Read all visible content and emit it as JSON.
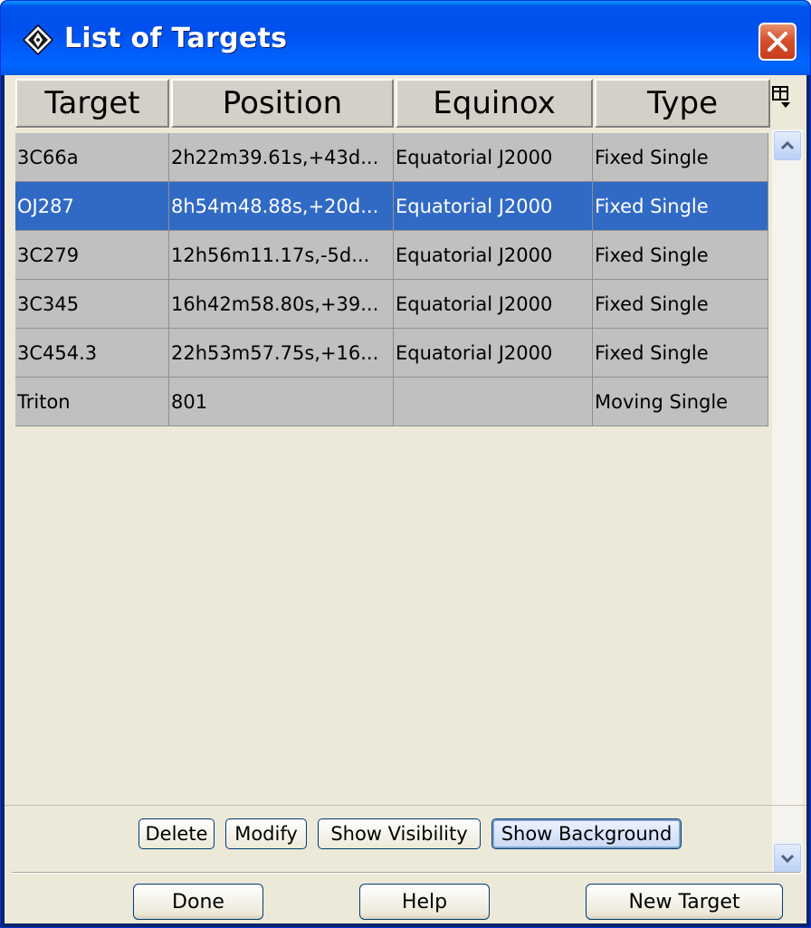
{
  "window": {
    "title": "List of Targets",
    "close_icon": "close-icon",
    "app_icon": "diamond-compass-icon"
  },
  "table": {
    "columns": [
      "Target",
      "Position",
      "Equinox",
      "Type"
    ],
    "column_chooser_icon": "column-chooser-icon",
    "selected_row": 1,
    "rows": [
      {
        "target": "3C66a",
        "position": "2h22m39.61s,+43d...",
        "equinox": "Equatorial J2000",
        "type": "Fixed Single"
      },
      {
        "target": "OJ287",
        "position": "8h54m48.88s,+20d...",
        "equinox": "Equatorial J2000",
        "type": "Fixed Single"
      },
      {
        "target": "3C279",
        "position": "12h56m11.17s,-5d...",
        "equinox": "Equatorial J2000",
        "type": "Fixed Single"
      },
      {
        "target": "3C345",
        "position": "16h42m58.80s,+39...",
        "equinox": "Equatorial J2000",
        "type": "Fixed Single"
      },
      {
        "target": "3C454.3",
        "position": "22h53m57.75s,+16...",
        "equinox": "Equatorial J2000",
        "type": "Fixed Single"
      },
      {
        "target": "Triton",
        "position": "801",
        "equinox": "",
        "type": "Moving Single"
      }
    ]
  },
  "scrollbar": {
    "up_icon": "chevron-up-icon",
    "down_icon": "chevron-down-icon"
  },
  "actions": {
    "delete": "Delete",
    "modify": "Modify",
    "show_visibility": "Show Visibility",
    "show_background": "Show Background"
  },
  "footer": {
    "done": "Done",
    "help": "Help",
    "new_target": "New Target"
  },
  "colors": {
    "titlebar": "#0054e3",
    "selection": "#316ac5",
    "row_background": "#c0c0c0",
    "panel": "#ece9d8"
  }
}
